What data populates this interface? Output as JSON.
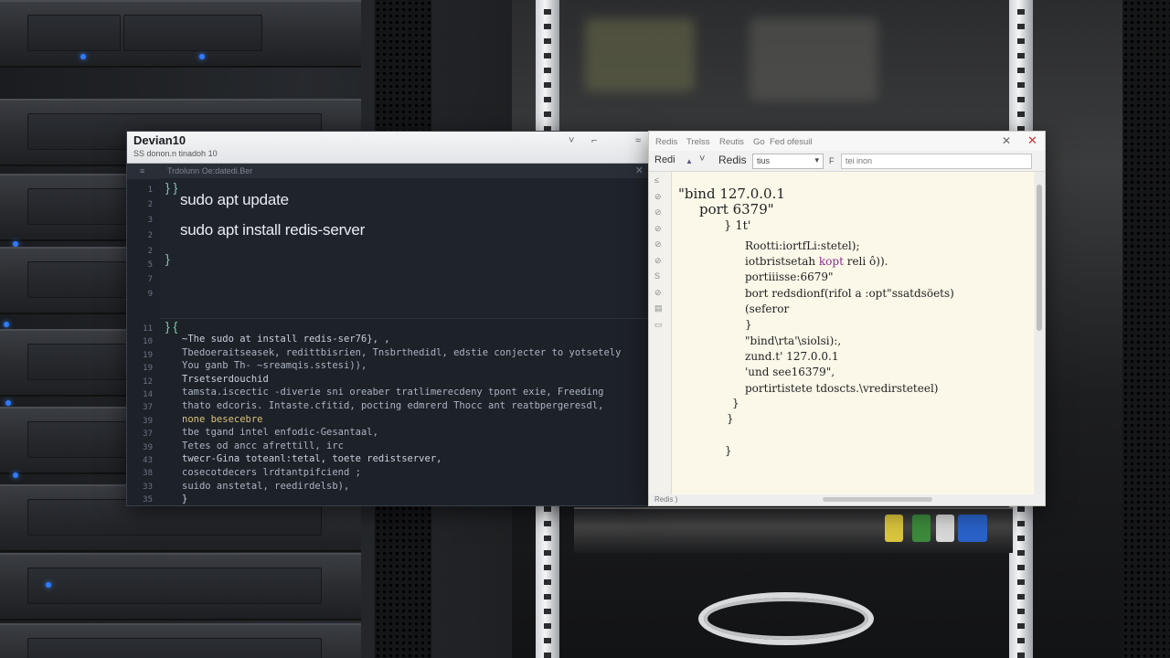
{
  "terminal": {
    "title": "Devian10",
    "subtitle": "SS donon.n tinadoh 10",
    "tab_label": "Trdolunn Oe:datedi.Ber",
    "commands": [
      "sudo apt update",
      "sudo apt install redis-server"
    ],
    "brace_open": "} }",
    "brace_close": "}",
    "brace_open_2": "} {",
    "top_line_numbers": [
      "1",
      "2",
      "3",
      "2",
      "2",
      "5",
      "7",
      "9"
    ],
    "bottom_line_numbers": [
      "11",
      "10",
      "19",
      "19",
      "12",
      "14",
      "37",
      "39",
      "37",
      "39",
      "43",
      "38",
      "33",
      "35"
    ],
    "output_lines": [
      "~The sudo at install redis-ser76}, ,",
      "  Tbedoeraitseasek, redittbisrien, Tnsbrthedidl, edstie conjecter to  yotsetely",
      "  You ganb Th- ~sreamqis.sstesi)),",
      "  Trsetserdouchid",
      "  tamsta.iscectic -diverie sni oreaber tratlimerecdeny tpont exie, Freeding",
      "  thato edcoris. Intaste.cfitid, pocting edmrerd Thocc ant reatbpergeresdl,",
      "  none  besecebre",
      "  tbe tgand intel enfodic-Gesantaal,",
      "  Tetes od ancc afrettill, irc",
      "  twecr-Gina toteanl:tetal, toete  redistserver,",
      "  cosecotdecers  lrdtantpifciend  ;",
      "  suido anstetal, reedirdelsb),",
      "  }"
    ]
  },
  "redis_window": {
    "menu": [
      "Redis",
      "Trelss",
      "Reutis",
      "Go",
      "Fed ofesuil"
    ],
    "toolbar": {
      "label": "Redi",
      "nav_up": "▲",
      "nav_down": "˅",
      "app_label": "Redis",
      "select_value": "tius",
      "search_prefix": "F",
      "search_value": "tei inon"
    },
    "sidebar_icons": [
      "≤",
      "⊘",
      "⊘",
      "⊘",
      "⊘",
      "⊘",
      "S",
      "⊘",
      "▤",
      "▭"
    ],
    "config_lines": [
      "\"bind 127.0.0.1",
      "port 6379\"",
      "} 1t'",
      "Rootti:iortfLi:stetel);",
      "iotbristsetah kopt  reli ô)).",
      "portiiisse:6679\"",
      "bort  redsdionf(rifol a  :opt\"ssatdsöets)",
      "(seferor",
      "}",
      "\"bind\\rta'\\siolsi):,",
      "zund.t' 127.0.0.1",
      "'und  see16379\",",
      "portirtistete tdoscts.\\vredirsteteel)",
      "}",
      "}",
      "}"
    ],
    "status": "Redis )"
  }
}
